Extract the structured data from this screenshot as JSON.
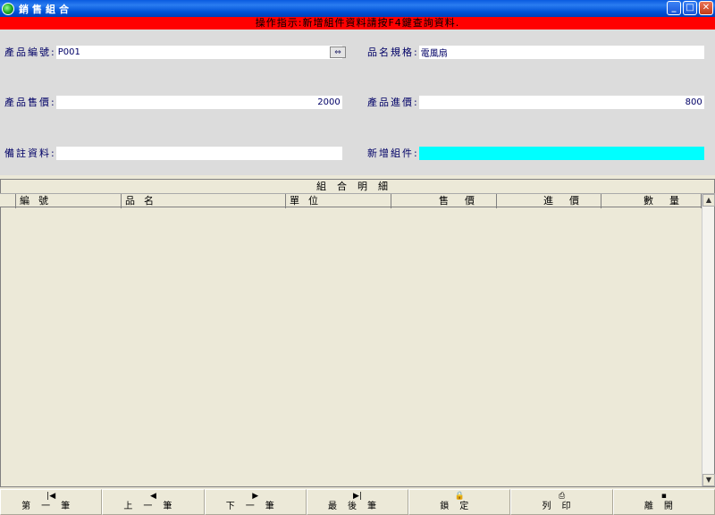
{
  "window": {
    "title": "銷售組合",
    "buttons": {
      "minimize": "_",
      "maximize": "□",
      "close": "✕"
    }
  },
  "hint": "操作指示:新增組件資料請按F4鍵查詢資料.",
  "form": {
    "product_code": {
      "label": "產品編號:",
      "value": "P001"
    },
    "product_spec": {
      "label": "品名規格:",
      "value": "電風扇"
    },
    "sale_price": {
      "label": "產品售價:",
      "value": "2000"
    },
    "cost_price": {
      "label": "產品進價:",
      "value": "800"
    },
    "remarks": {
      "label": "備註資料:",
      "value": ""
    },
    "add_component": {
      "label": "新增組件:",
      "value": ""
    }
  },
  "grid": {
    "caption": "組合明細",
    "columns": [
      "編號",
      "品名",
      "單位",
      "售價",
      "進價",
      "數量"
    ]
  },
  "toolbar": [
    {
      "icon": "first-record-icon",
      "glyph": "|◀",
      "label": "第一筆"
    },
    {
      "icon": "prev-record-icon",
      "glyph": "◀",
      "label": "上一筆"
    },
    {
      "icon": "next-record-icon",
      "glyph": "▶",
      "label": "下一筆"
    },
    {
      "icon": "last-record-icon",
      "glyph": "▶|",
      "label": "最後筆"
    },
    {
      "icon": "lock-icon",
      "glyph": "🔒",
      "label": "鎖定"
    },
    {
      "icon": "printer-icon",
      "glyph": "⎙",
      "label": "列印"
    },
    {
      "icon": "save-disk-icon",
      "glyph": "▪",
      "label": "離開"
    }
  ]
}
